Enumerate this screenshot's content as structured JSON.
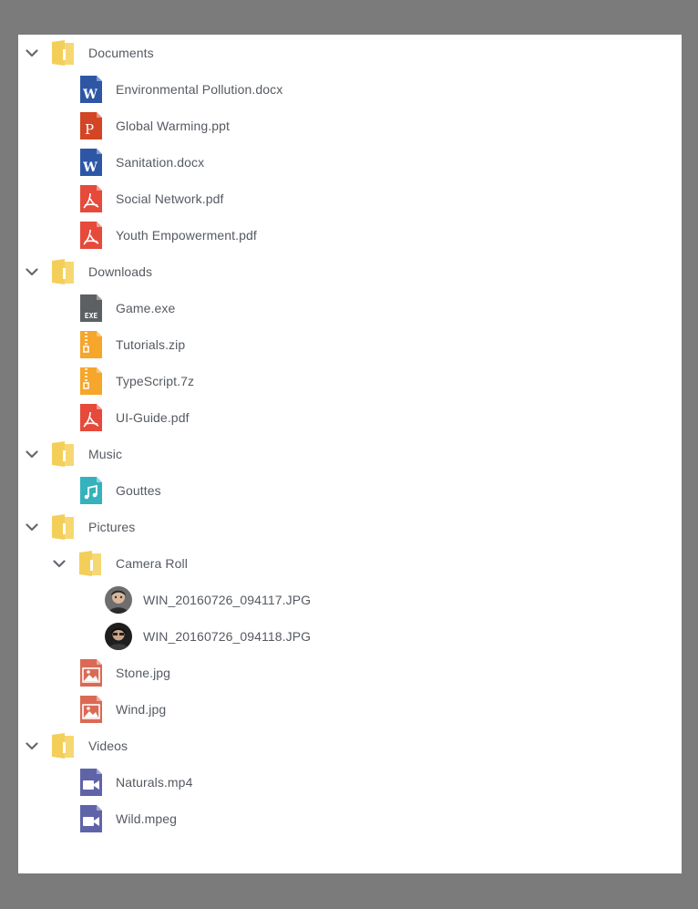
{
  "tree": {
    "documents": {
      "label": "Documents",
      "files": [
        {
          "name": "Environmental Pollution.docx",
          "icon": "word-doc-icon"
        },
        {
          "name": "Global Warming.ppt",
          "icon": "powerpoint-icon"
        },
        {
          "name": "Sanitation.docx",
          "icon": "word-doc-icon"
        },
        {
          "name": "Social Network.pdf",
          "icon": "pdf-icon"
        },
        {
          "name": "Youth Empowerment.pdf",
          "icon": "pdf-icon"
        }
      ]
    },
    "downloads": {
      "label": "Downloads",
      "files": [
        {
          "name": "Game.exe",
          "icon": "exe-icon"
        },
        {
          "name": "Tutorials.zip",
          "icon": "zip-icon"
        },
        {
          "name": "TypeScript.7z",
          "icon": "zip-icon"
        },
        {
          "name": "UI-Guide.pdf",
          "icon": "pdf-icon"
        }
      ]
    },
    "music": {
      "label": "Music",
      "files": [
        {
          "name": "Gouttes",
          "icon": "music-file-icon"
        }
      ]
    },
    "pictures": {
      "label": "Pictures",
      "camera_roll": {
        "label": "Camera Roll",
        "files": [
          {
            "name": "WIN_20160726_094117.JPG",
            "icon": "photo-thumbnail"
          },
          {
            "name": "WIN_20160726_094118.JPG",
            "icon": "photo-thumbnail"
          }
        ]
      },
      "files": [
        {
          "name": "Stone.jpg",
          "icon": "image-file-icon"
        },
        {
          "name": "Wind.jpg",
          "icon": "image-file-icon"
        }
      ]
    },
    "videos": {
      "label": "Videos",
      "files": [
        {
          "name": "Naturals.mp4",
          "icon": "video-file-icon"
        },
        {
          "name": "Wild.mpeg",
          "icon": "video-file-icon"
        }
      ]
    }
  },
  "colors": {
    "folder": "#f3cf5a",
    "word": "#2d57a5",
    "powerpoint": "#d24625",
    "pdf": "#e54a3b",
    "exe": "#5c6063",
    "zip": "#f5a62b",
    "music": "#35b2bd",
    "image": "#db6a55",
    "video": "#5f63a8",
    "text": "#555a61",
    "chevron": "#646970"
  }
}
